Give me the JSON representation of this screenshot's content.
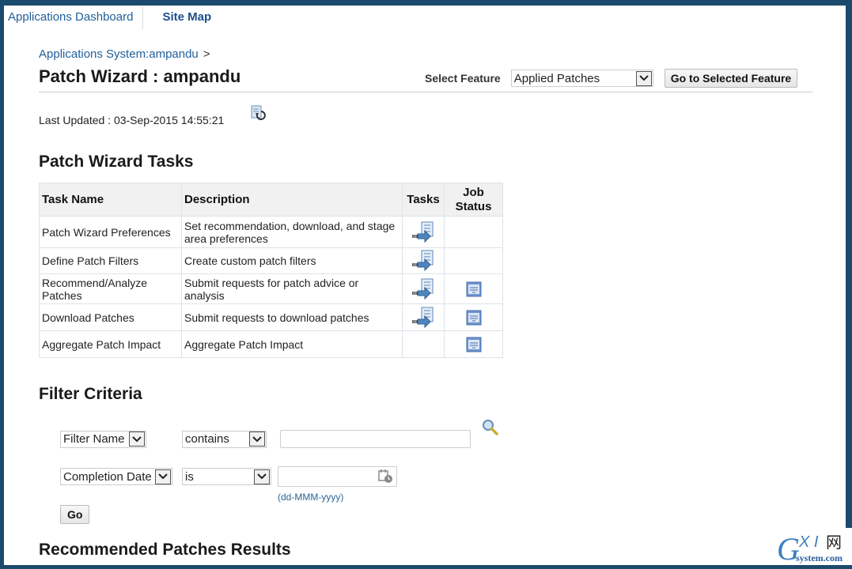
{
  "topnav": {
    "applications_dashboard": "Applications Dashboard",
    "site_map": "Site Map"
  },
  "breadcrumb": {
    "item": "Applications System:ampandu",
    "separator": ">"
  },
  "page_title": "Patch Wizard : ampandu",
  "feature": {
    "label": "Select Feature",
    "selected": "Applied Patches",
    "go_button": "Go to Selected Feature"
  },
  "last_updated": "Last Updated : 03-Sep-2015 14:55:21",
  "tasks_section": {
    "title": "Patch Wizard Tasks",
    "columns": [
      "Task Name",
      "Description",
      "Tasks",
      "Job",
      "Status"
    ],
    "rows": [
      {
        "name": "Patch Wizard Preferences",
        "description": "Set recommendation, download, and stage area preferences",
        "has_task": true,
        "has_status": false
      },
      {
        "name": "Define Patch Filters",
        "description": "Create custom patch filters",
        "has_task": true,
        "has_status": false
      },
      {
        "name": "Recommend/Analyze Patches",
        "description": "Submit requests for patch advice or analysis",
        "has_task": true,
        "has_status": true
      },
      {
        "name": "Download Patches",
        "description": "Submit requests to download patches",
        "has_task": true,
        "has_status": true
      },
      {
        "name": "Aggregate Patch Impact",
        "description": "Aggregate Patch Impact",
        "has_task": false,
        "has_status": true
      }
    ]
  },
  "filter_section": {
    "title": "Filter Criteria",
    "row1": {
      "field": "Filter Name",
      "operator": "contains",
      "value": ""
    },
    "row2": {
      "field": "Completion Date",
      "operator": "is",
      "value": ""
    },
    "date_hint": "(dd-MMM-yyyy)",
    "go_button": "Go"
  },
  "results_section": {
    "title": "Recommended Patches Results"
  },
  "watermark": {
    "text": "GXI网",
    "sub": "system.com"
  },
  "colors": {
    "frame": "#1b4b6c",
    "link": "#1f5f99"
  }
}
